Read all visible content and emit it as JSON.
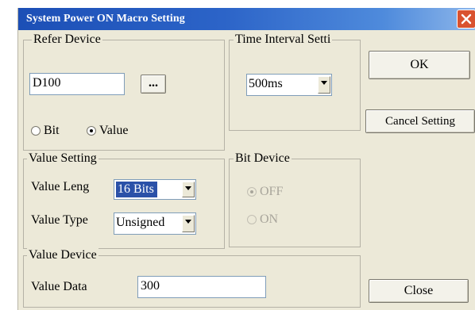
{
  "window": {
    "title": "System Power ON Macro Setting"
  },
  "refer_device": {
    "group_label": "Refer Device",
    "device_value": "D100",
    "browse_label": "...",
    "radio_bit_label": "Bit",
    "radio_value_label": "Value",
    "selected": "Value"
  },
  "time_interval": {
    "group_label": "Time Interval Setti",
    "selected": "500ms"
  },
  "value_setting": {
    "group_label": "Value Setting",
    "length_label": "Value Leng",
    "length_selected": "16 Bits",
    "type_label": "Value Type",
    "type_selected": "Unsigned"
  },
  "bit_device": {
    "group_label": "Bit Device",
    "off_label": "OFF",
    "on_label": "ON",
    "selected": "OFF",
    "enabled": false
  },
  "value_device": {
    "group_label": "Value Device",
    "data_label": "Value Data",
    "data_value": "300"
  },
  "buttons": {
    "ok": "OK",
    "cancel": "Cancel Setting",
    "close": "Close"
  }
}
